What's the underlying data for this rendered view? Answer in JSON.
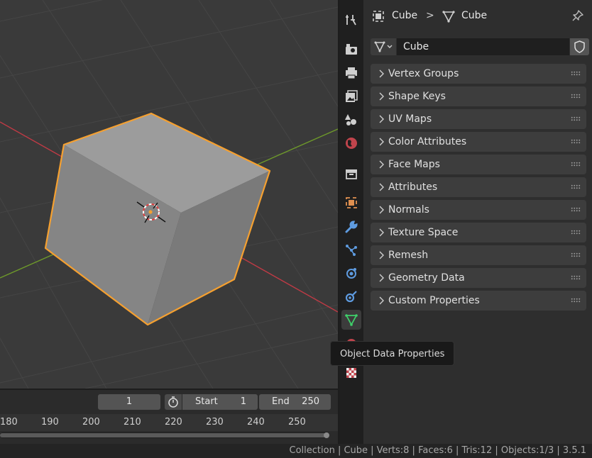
{
  "properties_header": {
    "object_name": "Cube",
    "separator": ">",
    "data_name": "Cube"
  },
  "datablock": {
    "name": "Cube"
  },
  "panels": [
    {
      "label": "Vertex Groups"
    },
    {
      "label": "Shape Keys"
    },
    {
      "label": "UV Maps"
    },
    {
      "label": "Color Attributes"
    },
    {
      "label": "Face Maps"
    },
    {
      "label": "Attributes"
    },
    {
      "label": "Normals"
    },
    {
      "label": "Texture Space"
    },
    {
      "label": "Remesh"
    },
    {
      "label": "Geometry Data"
    },
    {
      "label": "Custom Properties"
    }
  ],
  "tooltip": {
    "text": "Object Data Properties"
  },
  "property_tabs": [
    "tool-icon",
    "render-icon",
    "output-icon",
    "view-layer-icon",
    "scene-icon",
    "world-icon",
    "collection-icon",
    "object-icon",
    "modifier-icon",
    "particles-icon",
    "physics-icon",
    "constraints-icon",
    "object-data-icon",
    "material-icon",
    "texture-icon"
  ],
  "timeline": {
    "current_frame": "1",
    "start_label": "Start",
    "start_value": "1",
    "end_label": "End",
    "end_value": "250",
    "ticks": [
      "180",
      "190",
      "200",
      "210",
      "220",
      "230",
      "240",
      "250"
    ]
  },
  "status_bar": {
    "text": "Collection | Cube | Verts:8 | Faces:6 | Tris:12 | Objects:1/3 | 3.5.1"
  },
  "colors": {
    "selection_outline": "#f5a030",
    "active_tab_icon": "#3fd06a",
    "x_axis": "#c03a45",
    "y_axis": "#6e9a2a"
  }
}
